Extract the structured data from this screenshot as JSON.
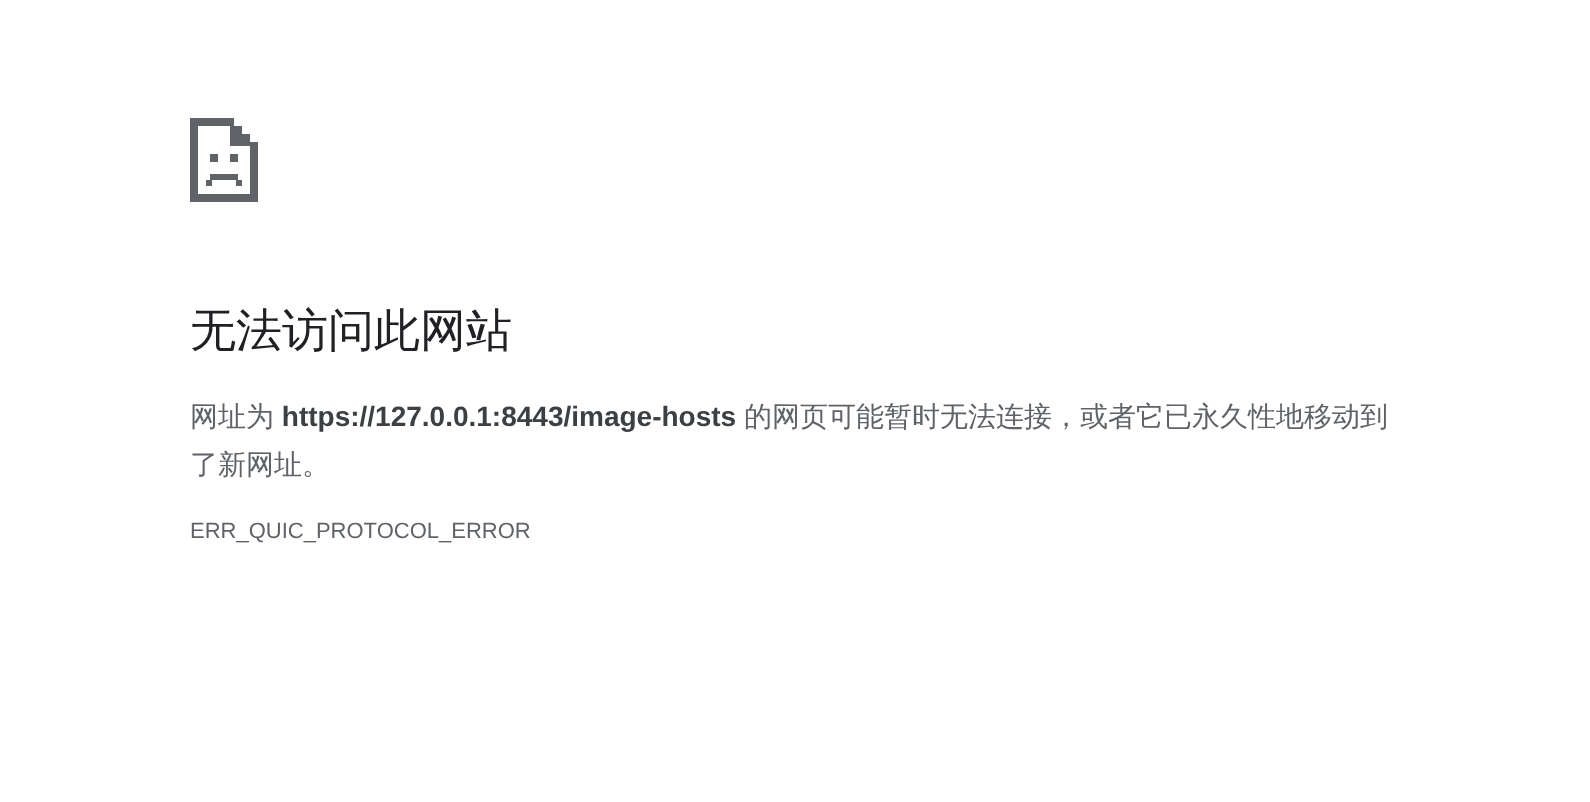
{
  "heading": "无法访问此网站",
  "message": "网址为 **https://127.0.0.1:8443/image-hosts** 的网页可能暂时无法连接，或者它已永久性地移动到了新网址。",
  "error_code": "ERR_QUIC_PROTOCOL_ERROR"
}
